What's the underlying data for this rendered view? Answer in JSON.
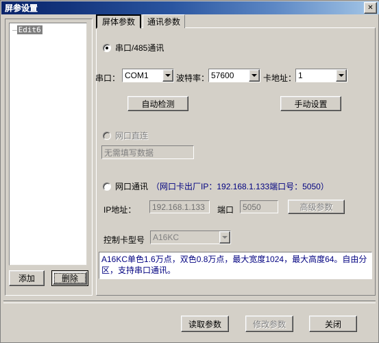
{
  "window": {
    "title": "屏参设置",
    "close_icon": "close-icon",
    "close_label": "✕"
  },
  "sidebar": {
    "tree": {
      "dash": "—",
      "items": [
        {
          "label": "Edit6",
          "selected": true
        }
      ]
    },
    "buttons": {
      "add": "添加",
      "delete": "删除"
    }
  },
  "tabs": [
    {
      "label": "屏体参数",
      "active": true
    },
    {
      "label": "通讯参数",
      "active": false
    }
  ],
  "main": {
    "serial": {
      "radio_label": "串口/485通讯",
      "checked": true,
      "port_label": "串口：",
      "port_value": "COM1",
      "baud_label": "波特率：",
      "baud_value": "57600",
      "card_addr_label": "卡地址：",
      "card_addr_value": "1",
      "auto_detect_button": "自动检测",
      "manual_setup_button": "手动设置"
    },
    "direct": {
      "radio_label": "网口直连",
      "checked": false,
      "disabled": true,
      "field_value": "无需填写数据"
    },
    "network": {
      "radio_label": "网口通讯",
      "checked": false,
      "hint": "（网口卡出厂IP：192.168.1.133端口号：5050）",
      "hint_color": "#000080",
      "ip_label": "IP地址：",
      "ip_value": "192.168.1.133",
      "port_label": "端口",
      "port_value": "5050",
      "advanced_button": "高级参数"
    },
    "card": {
      "model_label": "控制卡型号",
      "model_value": "A16KC"
    },
    "description": "A16KC单色1.6万点，双色0.8万点，最大宽度1024，最大高度64。自由分区，支持串口通讯。"
  },
  "footer": {
    "read_params": "读取参数",
    "modify_params": "修改参数",
    "close": "关闭"
  }
}
